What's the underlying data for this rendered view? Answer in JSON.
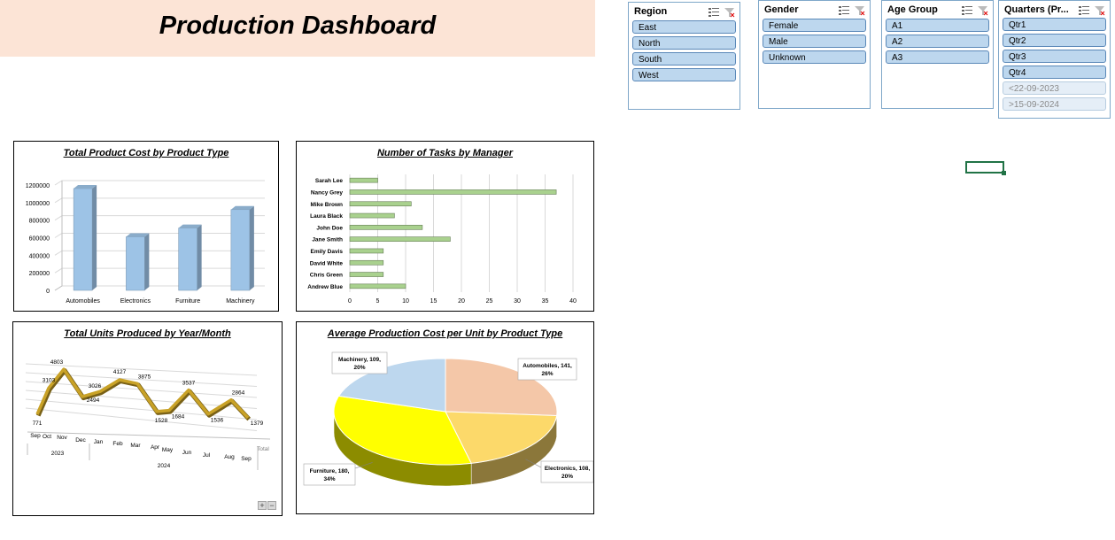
{
  "header": {
    "title": "Production Dashboard"
  },
  "slicers": [
    {
      "title": "Region",
      "items": [
        {
          "label": "East",
          "state": "selected"
        },
        {
          "label": "North",
          "state": "selected"
        },
        {
          "label": "South",
          "state": "selected"
        },
        {
          "label": "West",
          "state": "selected"
        }
      ]
    },
    {
      "title": "Gender",
      "items": [
        {
          "label": "Female",
          "state": "selected"
        },
        {
          "label": "Male",
          "state": "selected"
        },
        {
          "label": "Unknown",
          "state": "selected"
        }
      ]
    },
    {
      "title": "Age Group",
      "items": [
        {
          "label": "A1",
          "state": "selected"
        },
        {
          "label": "A2",
          "state": "selected"
        },
        {
          "label": "A3",
          "state": "selected"
        }
      ]
    },
    {
      "title": "Quarters (Pr...",
      "items": [
        {
          "label": "Qtr1",
          "state": "selected"
        },
        {
          "label": "Qtr2",
          "state": "selected"
        },
        {
          "label": "Qtr3",
          "state": "selected"
        },
        {
          "label": "Qtr4",
          "state": "selected"
        },
        {
          "label": "<22-09-2023",
          "state": "dimmed"
        },
        {
          "label": ">15-09-2024",
          "state": "dimmed"
        }
      ]
    }
  ],
  "zoom_controls": {
    "plus": "+",
    "minus": "−"
  },
  "chart_data": [
    {
      "type": "bar",
      "title": "Total Product Cost by Product Type",
      "categories": [
        "Automobiles",
        "Electronics",
        "Furniture",
        "Machinery"
      ],
      "values": [
        1160000,
        610000,
        710000,
        920000
      ],
      "yticks": [
        "0",
        "200000",
        "400000",
        "600000",
        "800000",
        "1000000",
        "1200000"
      ],
      "ylim": [
        0,
        1200000
      ],
      "color": "#9dc3e6",
      "grid": true
    },
    {
      "type": "bar",
      "orientation": "horizontal",
      "title": "Number of Tasks by Manager",
      "categories": [
        "Sarah Lee",
        "Nancy Grey",
        "Mike Brown",
        "Laura Black",
        "John Doe",
        "Jane Smith",
        "Emily Davis",
        "David White",
        "Chris Green",
        "Andrew Blue"
      ],
      "values": [
        5,
        37,
        11,
        8,
        13,
        18,
        6,
        6,
        6,
        10
      ],
      "xticks": [
        "0",
        "5",
        "10",
        "15",
        "20",
        "25",
        "30",
        "35",
        "40"
      ],
      "xlim": [
        0,
        40
      ],
      "color": "#a9d18e",
      "grid": true
    },
    {
      "type": "line",
      "title": "Total Units Produced  by Year/Month",
      "x": [
        "Sep",
        "Oct",
        "Nov",
        "Dec",
        "Jan",
        "Feb",
        "Mar",
        "Apr",
        "May",
        "Jun",
        "Jul",
        "Aug",
        "Sep"
      ],
      "x_groups": [
        {
          "label": "2023",
          "months": [
            "Sep",
            "Oct",
            "Nov",
            "Dec"
          ]
        },
        {
          "label": "2024",
          "months": [
            "Jan",
            "Feb",
            "Mar",
            "Apr",
            "May",
            "Jun",
            "Jul",
            "Aug",
            "Sep"
          ]
        }
      ],
      "values": [
        771,
        3103,
        4803,
        2494,
        3026,
        4127,
        3875,
        1528,
        1684,
        3537,
        1536,
        2864,
        1379
      ],
      "series_label": "Total",
      "color": "#c9a227"
    },
    {
      "type": "pie",
      "title": "Average Production Cost per Unit by Product Type",
      "slices": [
        {
          "label": "Automobiles",
          "value": 141,
          "percent": "26%",
          "color": "#f4c7a8"
        },
        {
          "label": "Electronics",
          "value": 108,
          "percent": "20%",
          "color": "#fcd96a"
        },
        {
          "label": "Furniture",
          "value": 180,
          "percent": "34%",
          "color": "#ffff00"
        },
        {
          "label": "Machinery",
          "value": 109,
          "percent": "20%",
          "color": "#bdd7ee"
        }
      ],
      "data_labels": [
        {
          "line1": "Automobiles, 141,",
          "line2": "26%"
        },
        {
          "line1": "Electronics, 108,",
          "line2": "20%"
        },
        {
          "line1": "Furniture, 180,",
          "line2": "34%"
        },
        {
          "line1": "Machinery, 109,",
          "line2": "20%"
        }
      ]
    }
  ]
}
